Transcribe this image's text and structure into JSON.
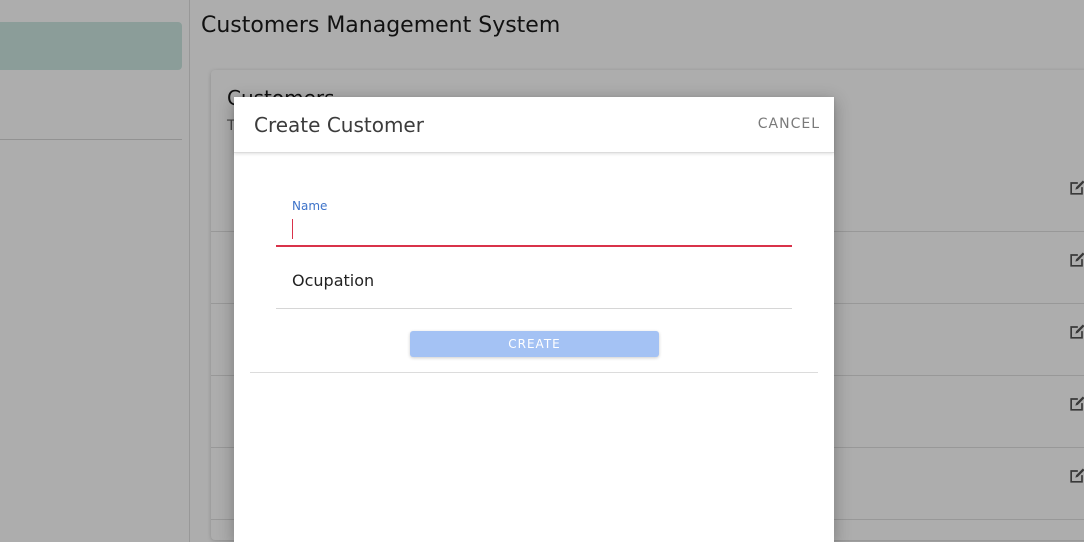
{
  "app": {
    "title": "Customers Management System"
  },
  "card": {
    "title": "Customers",
    "subtitle": "T"
  },
  "rows": [
    {
      "icon": "edit-icon"
    },
    {
      "icon": "edit-icon"
    },
    {
      "icon": "edit-icon"
    },
    {
      "icon": "edit-icon"
    },
    {
      "icon": "edit-icon"
    }
  ],
  "dialog": {
    "title": "Create Customer",
    "cancel_label": "CANCEL",
    "name_label": "Name",
    "name_value": "",
    "occupation_placeholder": "Ocupation",
    "create_label": "CREATE"
  },
  "colors": {
    "accent_blue": "#3e73c9",
    "error_red": "#d9324a",
    "create_button_disabled": "#a4c2f4",
    "sidebar_active": "#cde8e2"
  }
}
